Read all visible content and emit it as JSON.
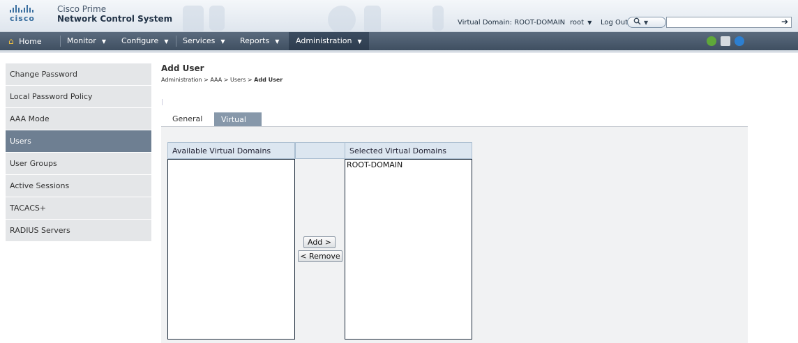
{
  "header": {
    "logo_text": "cisco",
    "product_line1": "Cisco Prime",
    "product_line2": "Network Control System",
    "virtual_domain": "Virtual Domain: ROOT-DOMAIN",
    "user_label": "root",
    "logout_label": "Log Out",
    "search_placeholder": "",
    "search_icon": "magnifier-icon",
    "go_icon": "arrow-right-icon"
  },
  "nav": {
    "home": "Home",
    "monitor": "Monitor",
    "configure": "Configure",
    "services": "Services",
    "reports": "Reports",
    "administration": "Administration",
    "tools": [
      "refresh-icon",
      "print-icon",
      "help-icon"
    ]
  },
  "sidebar": {
    "items": [
      {
        "label": "Change Password"
      },
      {
        "label": "Local Password Policy"
      },
      {
        "label": "AAA Mode"
      },
      {
        "label": "Users"
      },
      {
        "label": "User Groups"
      },
      {
        "label": "Active Sessions"
      },
      {
        "label": "TACACS+"
      },
      {
        "label": "RADIUS Servers"
      }
    ],
    "active": "Users"
  },
  "main": {
    "title": "Add User",
    "breadcrumb": {
      "path": "Administration > AAA > Users > ",
      "current": "Add User"
    },
    "tabs": [
      {
        "label": "General"
      },
      {
        "label": "Virtual Domains"
      }
    ],
    "selected_tab": "Virtual Domains",
    "available_header": "Available Virtual Domains",
    "selected_header": "Selected Virtual Domains",
    "available_items": [],
    "selected_items": [
      "ROOT-DOMAIN"
    ],
    "add_button": "Add >",
    "remove_button": "< Remove"
  },
  "colors": {
    "nav_bg": "#4a5a6d",
    "sidebar_active": "#6e7f92",
    "tab_selected": "#8798aa",
    "list_header": "#dce6f0"
  }
}
